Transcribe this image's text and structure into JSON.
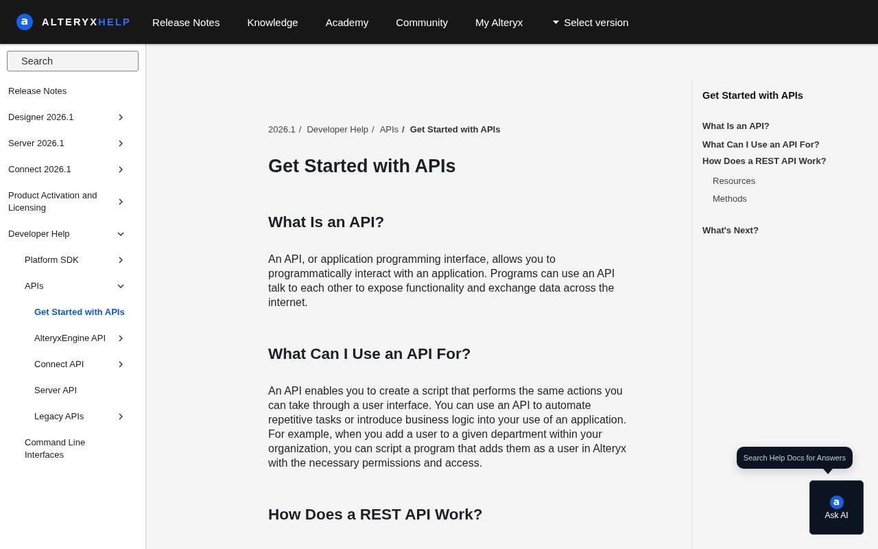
{
  "header": {
    "logo": {
      "mark": "a",
      "brand": "ALTERYX",
      "product": "HELP"
    },
    "nav": [
      {
        "label": "Release Notes"
      },
      {
        "label": "Knowledge"
      },
      {
        "label": "Academy"
      },
      {
        "label": "Community"
      },
      {
        "label": "My Alteryx"
      }
    ],
    "version_menu": {
      "label": "Select version"
    }
  },
  "sidebar": {
    "search": {
      "placeholder": "Search"
    },
    "items": [
      {
        "label": "Release Notes",
        "kind": "page",
        "selected": false
      },
      {
        "label": "Designer 2026.1",
        "kind": "group",
        "expanded": false,
        "selected": false
      },
      {
        "label": "Server 2026.1",
        "kind": "group",
        "expanded": false,
        "selected": false
      },
      {
        "label": "Connect 2026.1",
        "kind": "group",
        "expanded": false,
        "selected": false
      },
      {
        "label": "Product Activation and Licensing",
        "kind": "group",
        "expanded": false,
        "selected": false
      },
      {
        "label": "Developer Help",
        "kind": "group",
        "expanded": true,
        "selected": false,
        "children": [
          {
            "label": "Platform SDK",
            "kind": "group",
            "expanded": false,
            "selected": false
          },
          {
            "label": "APIs",
            "kind": "group",
            "expanded": true,
            "selected": false,
            "children": [
              {
                "label": "Get Started with APIs",
                "kind": "page",
                "selected": true
              },
              {
                "label": "AlteryxEngine API",
                "kind": "group",
                "expanded": false,
                "selected": false
              },
              {
                "label": "Connect API",
                "kind": "group",
                "expanded": false,
                "selected": false
              },
              {
                "label": "Server API",
                "kind": "page",
                "selected": false
              },
              {
                "label": "Legacy APIs",
                "kind": "group",
                "expanded": false,
                "selected": false
              }
            ]
          },
          {
            "label": "Command Line Interfaces",
            "kind": "page",
            "selected": false
          }
        ]
      }
    ]
  },
  "breadcrumb": {
    "separator": "/",
    "items": [
      {
        "label": "2026.1",
        "current": false
      },
      {
        "label": "Developer Help",
        "current": false
      },
      {
        "label": "APIs",
        "current": false
      },
      {
        "label": "Get Started with APIs",
        "current": true
      }
    ]
  },
  "article": {
    "title": "Get Started with APIs",
    "sections": [
      {
        "heading": "What Is an API?",
        "paragraphs": [
          "An API, or application programming interface, allows you to programmatically interact with an application. Programs can use an API talk to each other to expose functionality and exchange data across the internet."
        ]
      },
      {
        "heading": "What Can I Use an API For?",
        "paragraphs": [
          "An API enables you to create a script that performs the same actions you can take through a user interface. You can use an API to automate repetitive tasks or introduce business logic into your use of an application. For example, when you add a user to a given department within your organization, you can script a program that adds them as a user in Alteryx with the necessary permissions and access."
        ]
      },
      {
        "heading": "How Does a REST API Work?"
      }
    ]
  },
  "toc": {
    "title": "Get Started with APIs",
    "items": [
      {
        "label": "What Is an API?"
      },
      {
        "label": "What Can I Use an API For?"
      },
      {
        "label": "How Does a REST API Work?",
        "children": [
          {
            "label": "Resources"
          },
          {
            "label": "Methods"
          }
        ]
      },
      {
        "label": "What's Next?"
      }
    ]
  },
  "ask_ai": {
    "tooltip": "Search Help Docs for Answers",
    "mark": "a",
    "label": "Ask AI"
  }
}
